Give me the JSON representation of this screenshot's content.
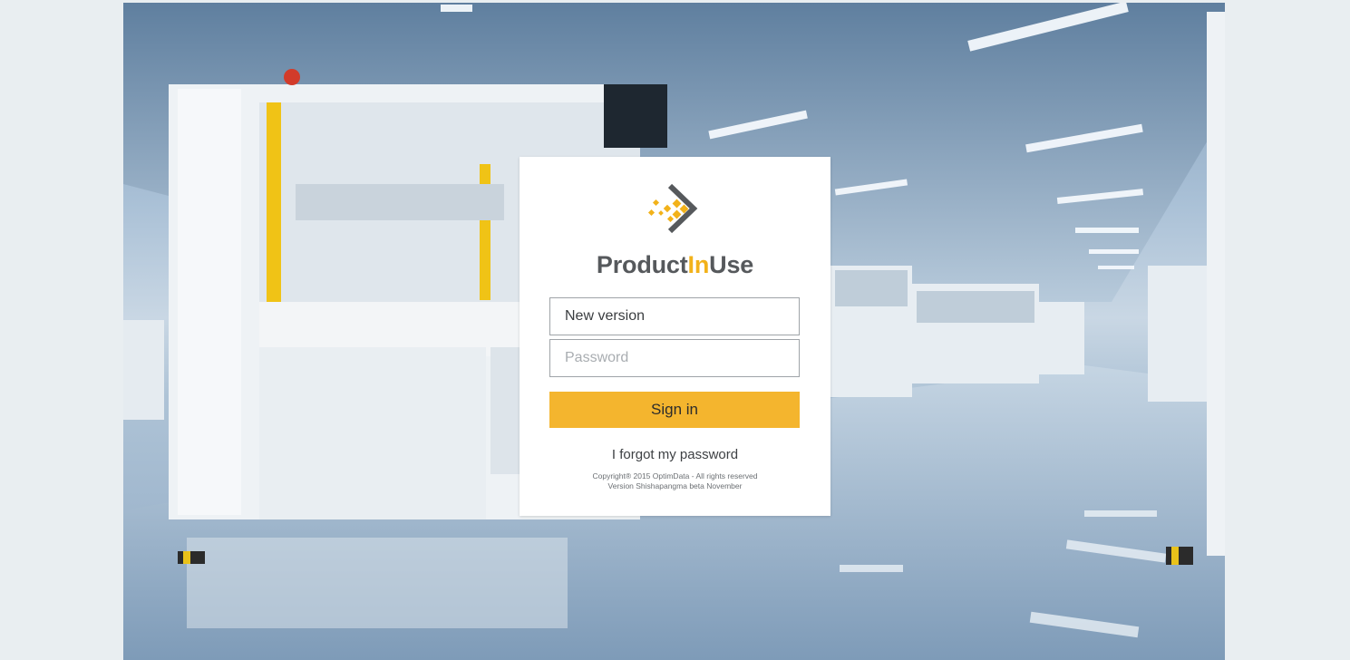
{
  "brand": {
    "name_prefix": "Product",
    "name_accent": "In",
    "name_suffix": "Use",
    "accent_color": "#f2b21a",
    "text_color": "#56595c"
  },
  "login": {
    "username_value": "New version",
    "password_placeholder": "Password",
    "signin_label": "Sign in",
    "forgot_label": "I forgot my password",
    "button_color": "#f4b52e"
  },
  "footer": {
    "copyright": "Copyright® 2015 OptimData - All rights reserved",
    "version": "Version Shishapangma beta November"
  },
  "icons": {
    "logo": "productinuse-logo-icon"
  }
}
